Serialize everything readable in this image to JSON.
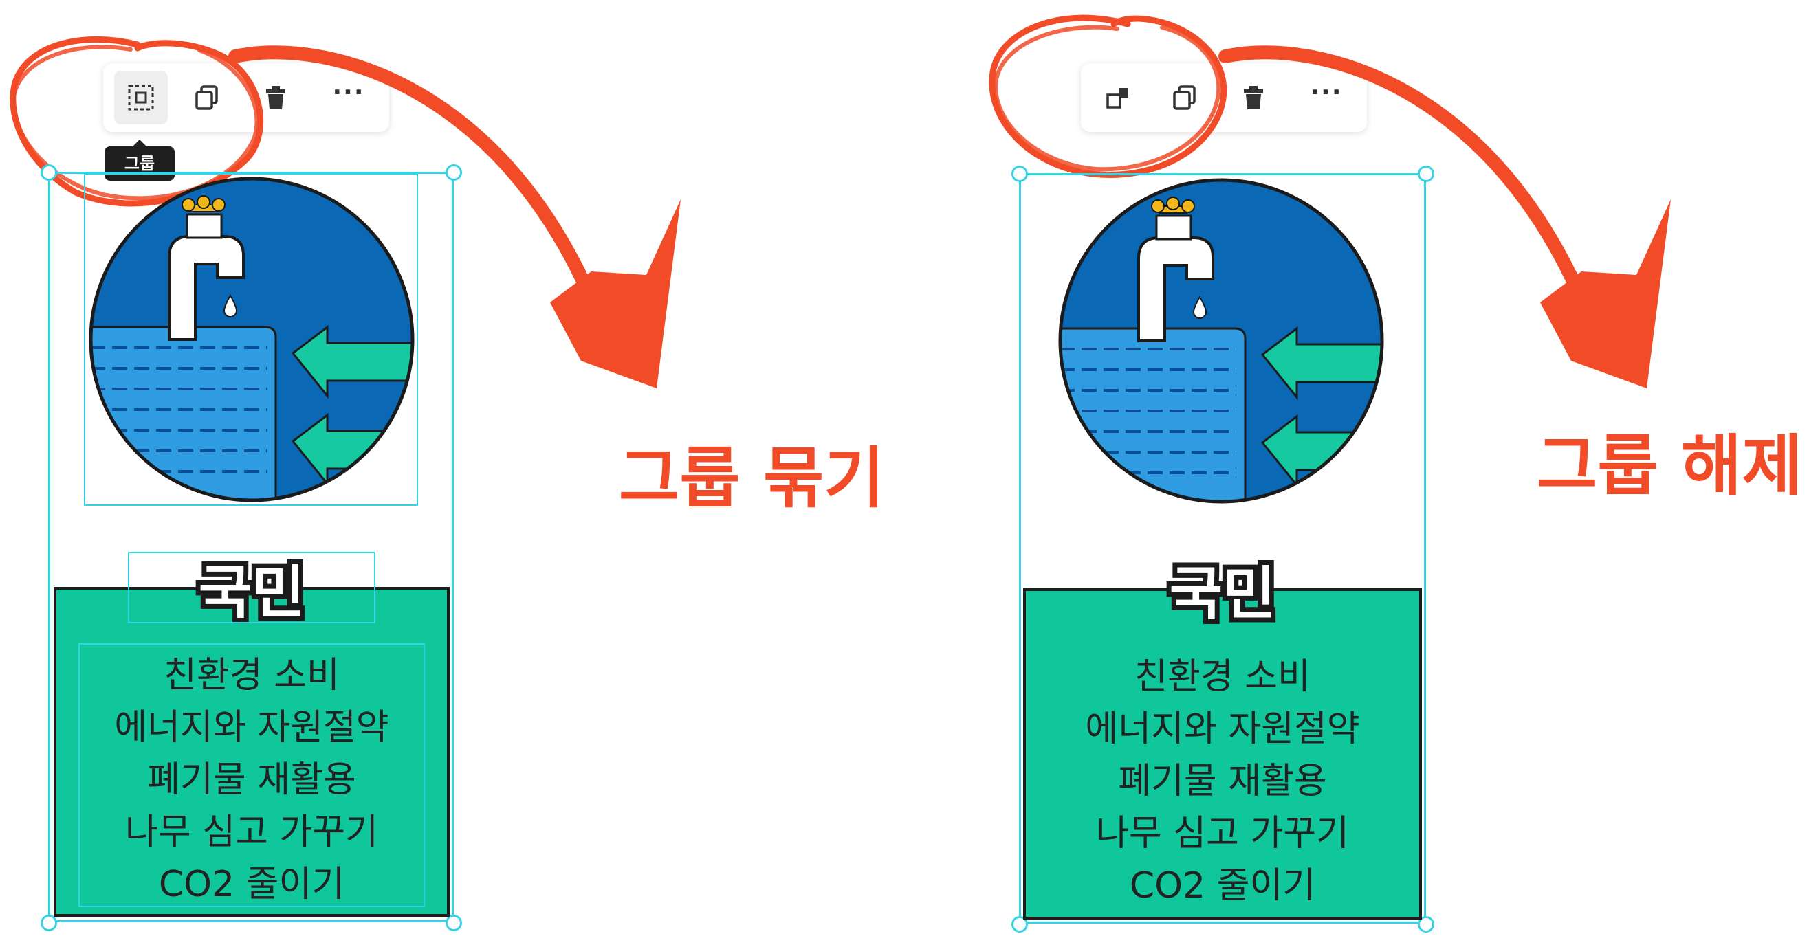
{
  "panels": [
    {
      "id": "left",
      "tooltip": "그룹",
      "card_title": "국민",
      "card_lines": [
        "친환경 소비",
        "에너지와 자원절약",
        "폐기물 재활용",
        "나무 심고 가꾸기",
        "CO2 줄이기"
      ],
      "caption": "그룹 묶기",
      "first_icon": "group-icon"
    },
    {
      "id": "right",
      "card_title": "국민",
      "card_lines": [
        "친환경 소비",
        "에너지와 자원절약",
        "폐기물 재활용",
        "나무 심고 가꾸기",
        "CO2 줄이기"
      ],
      "caption": "그룹 해제",
      "first_icon": "ungroup-icon"
    }
  ],
  "toolbar_icons": [
    "copy-icon",
    "trash-icon",
    "more-icon"
  ],
  "toolbar_more_label": "···",
  "colors": {
    "accent_red": "#f14b27",
    "selection": "#35d3e6",
    "card_green": "#0fc79b",
    "circle_blue": "#0a68b5",
    "water_blue": "#2f9be0",
    "arrow_green": "#16c9a0"
  }
}
